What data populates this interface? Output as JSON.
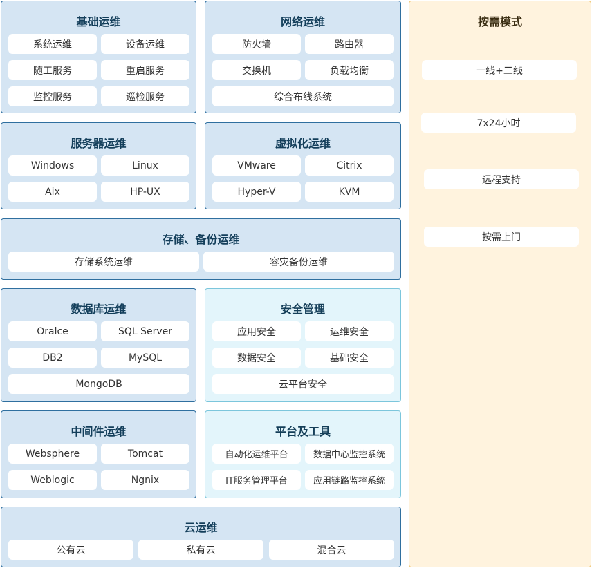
{
  "jichu": {
    "title": "基础运维",
    "items": [
      "系统运维",
      "设备运维",
      "随工服务",
      "重启服务",
      "监控服务",
      "巡检服务"
    ]
  },
  "wangluo": {
    "title": "网络运维",
    "items": [
      "防火墙",
      "路由器",
      "交换机",
      "负载均衡",
      "综合布线系统"
    ]
  },
  "fuwuqi": {
    "title": "服务器运维",
    "items": [
      "Windows",
      "Linux",
      "Aix",
      "HP-UX"
    ]
  },
  "xuni": {
    "title": "虚拟化运维",
    "items": [
      "VMware",
      "Citrix",
      "Hyper-V",
      "KVM"
    ]
  },
  "cunchu": {
    "title": "存储、备份运维",
    "items": [
      "存储系统运维",
      "容灾备份运维"
    ]
  },
  "shujuku": {
    "title": "数据库运维",
    "items": [
      "Oralce",
      "SQL Server",
      "DB2",
      "MySQL",
      "MongoDB"
    ]
  },
  "anquan": {
    "title": "安全管理",
    "items": [
      "应用安全",
      "运维安全",
      "数据安全",
      "基础安全",
      "云平台安全"
    ]
  },
  "zhongjian": {
    "title": "中间件运维",
    "items": [
      "Websphere",
      "Tomcat",
      "Weblogic",
      "Ngnix"
    ]
  },
  "pingtai": {
    "title": "平台及工具",
    "items": [
      "自动化运维平台",
      "数据中心监控系统",
      "IT服务管理平台",
      "应用链路监控系统"
    ]
  },
  "yun": {
    "title": "云运维",
    "items": [
      "公有云",
      "私有云",
      "混合云"
    ]
  },
  "mode": {
    "title": "按需模式",
    "items": [
      "一线+二线",
      "7x24小时",
      "远程支持",
      "按需上门"
    ]
  }
}
